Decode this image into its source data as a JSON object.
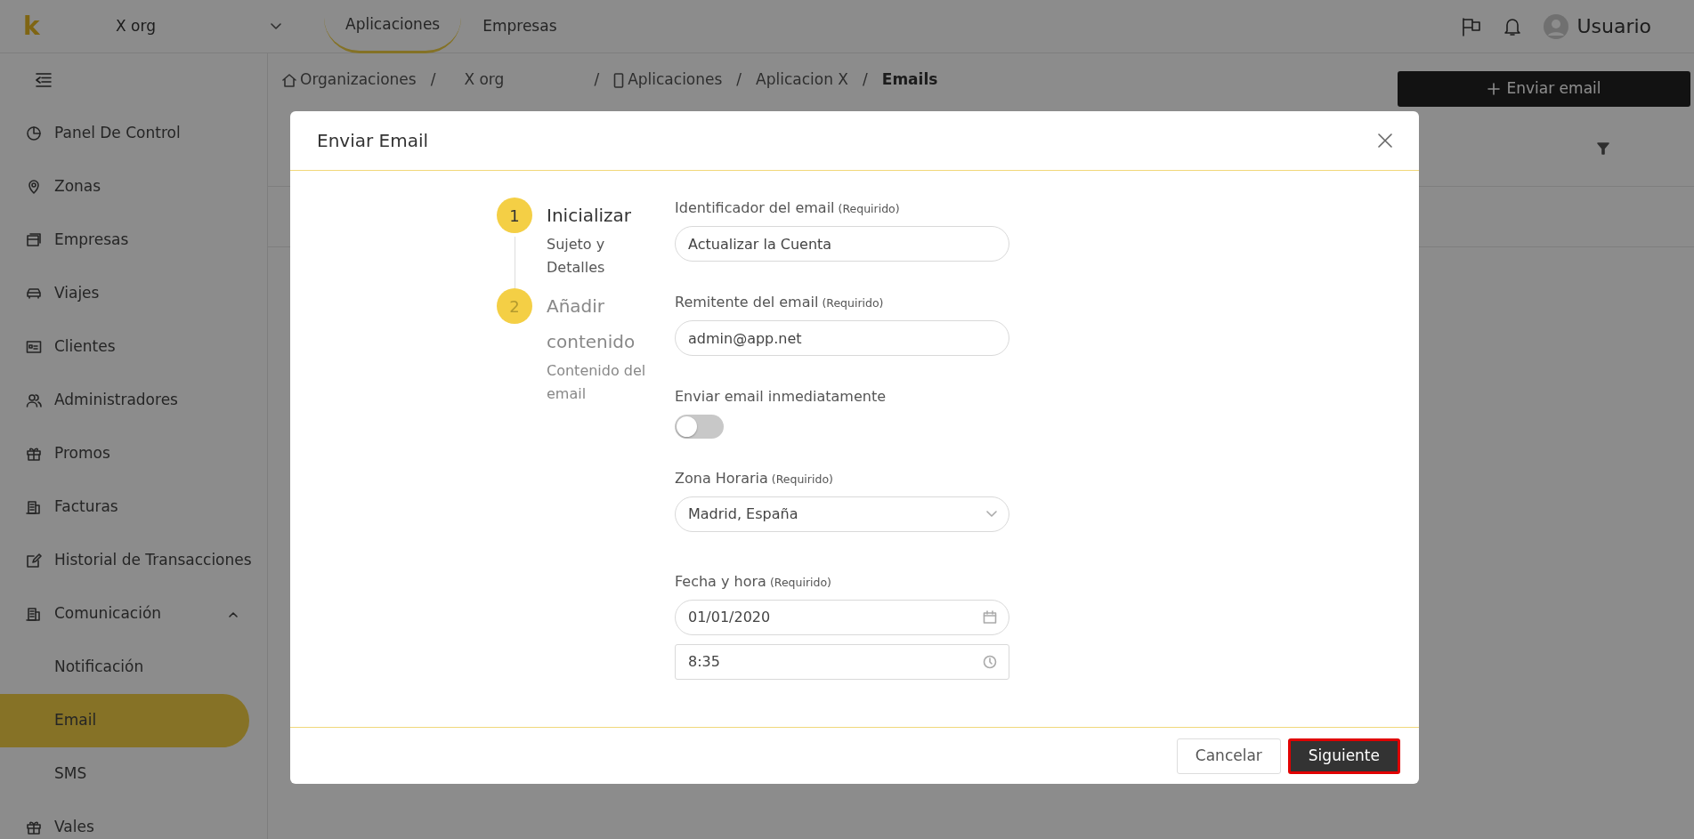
{
  "topbar": {
    "logo": "k",
    "org_select": {
      "value": "X org"
    },
    "tabs": [
      {
        "label": "Aplicaciones",
        "selected": true
      },
      {
        "label": "Empresas",
        "selected": false
      }
    ],
    "user": {
      "name": "Usuario"
    }
  },
  "sidebar": {
    "items": [
      {
        "label": "Panel De Control",
        "selected": false
      },
      {
        "label": "Zonas",
        "selected": false
      },
      {
        "label": "Empresas",
        "selected": false
      },
      {
        "label": "Viajes",
        "selected": false
      },
      {
        "label": "Clientes",
        "selected": false
      },
      {
        "label": "Administradores",
        "selected": false
      },
      {
        "label": "Promos",
        "selected": false
      },
      {
        "label": "Facturas",
        "selected": false
      },
      {
        "label": "Historial de Transacciones",
        "selected": false
      },
      {
        "label": "Comunicación",
        "selected": false,
        "expanded": true,
        "children": [
          {
            "label": "Notificación",
            "selected": false
          },
          {
            "label": "Email",
            "selected": true
          },
          {
            "label": "SMS",
            "selected": false
          }
        ]
      },
      {
        "label": "Vales",
        "selected": false
      }
    ]
  },
  "breadcrumb": [
    {
      "label": "Organizaciones",
      "current": false
    },
    {
      "separator": "/",
      "label": "X org",
      "current": false
    },
    {
      "separator": "/",
      "label": "Aplicaciones",
      "current": false
    },
    {
      "separator": "/",
      "label": "Aplicacion X",
      "current": false
    },
    {
      "separator": "/",
      "label": "Emails",
      "current": true
    }
  ],
  "action_button": {
    "label": "Enviar email"
  },
  "modal": {
    "title": "Enviar Email",
    "steps": [
      {
        "number": "1",
        "title": "Inicializar",
        "subtitle": "Sujeto y Detalles",
        "selected": true
      },
      {
        "number": "2",
        "title": "Añadir contenido",
        "subtitle": "Contenido del email",
        "selected": false
      }
    ],
    "fields": [
      {
        "kind": "text",
        "label": "Identificador del email",
        "note": "(Requirido)",
        "value": "Actualizar la Cuenta"
      },
      {
        "kind": "text",
        "label": "Remitente del email",
        "note": "(Requirido)",
        "value": "admin@app.net"
      },
      {
        "kind": "toggle",
        "label": "Enviar email inmediatamente",
        "on": false
      },
      {
        "kind": "select",
        "label": "Zona Horaria",
        "note": "(Requirido)",
        "value": "Madrid, España"
      },
      {
        "kind": "datetime",
        "label": "Fecha y hora",
        "note": "(Requirido)",
        "date": "01/01/2020",
        "time": "8:35"
      }
    ],
    "buttons": [
      {
        "label": "Cancelar",
        "kind": "secondary",
        "focused": false
      },
      {
        "label": "Siguiente",
        "kind": "primary",
        "focused": true
      }
    ]
  }
}
